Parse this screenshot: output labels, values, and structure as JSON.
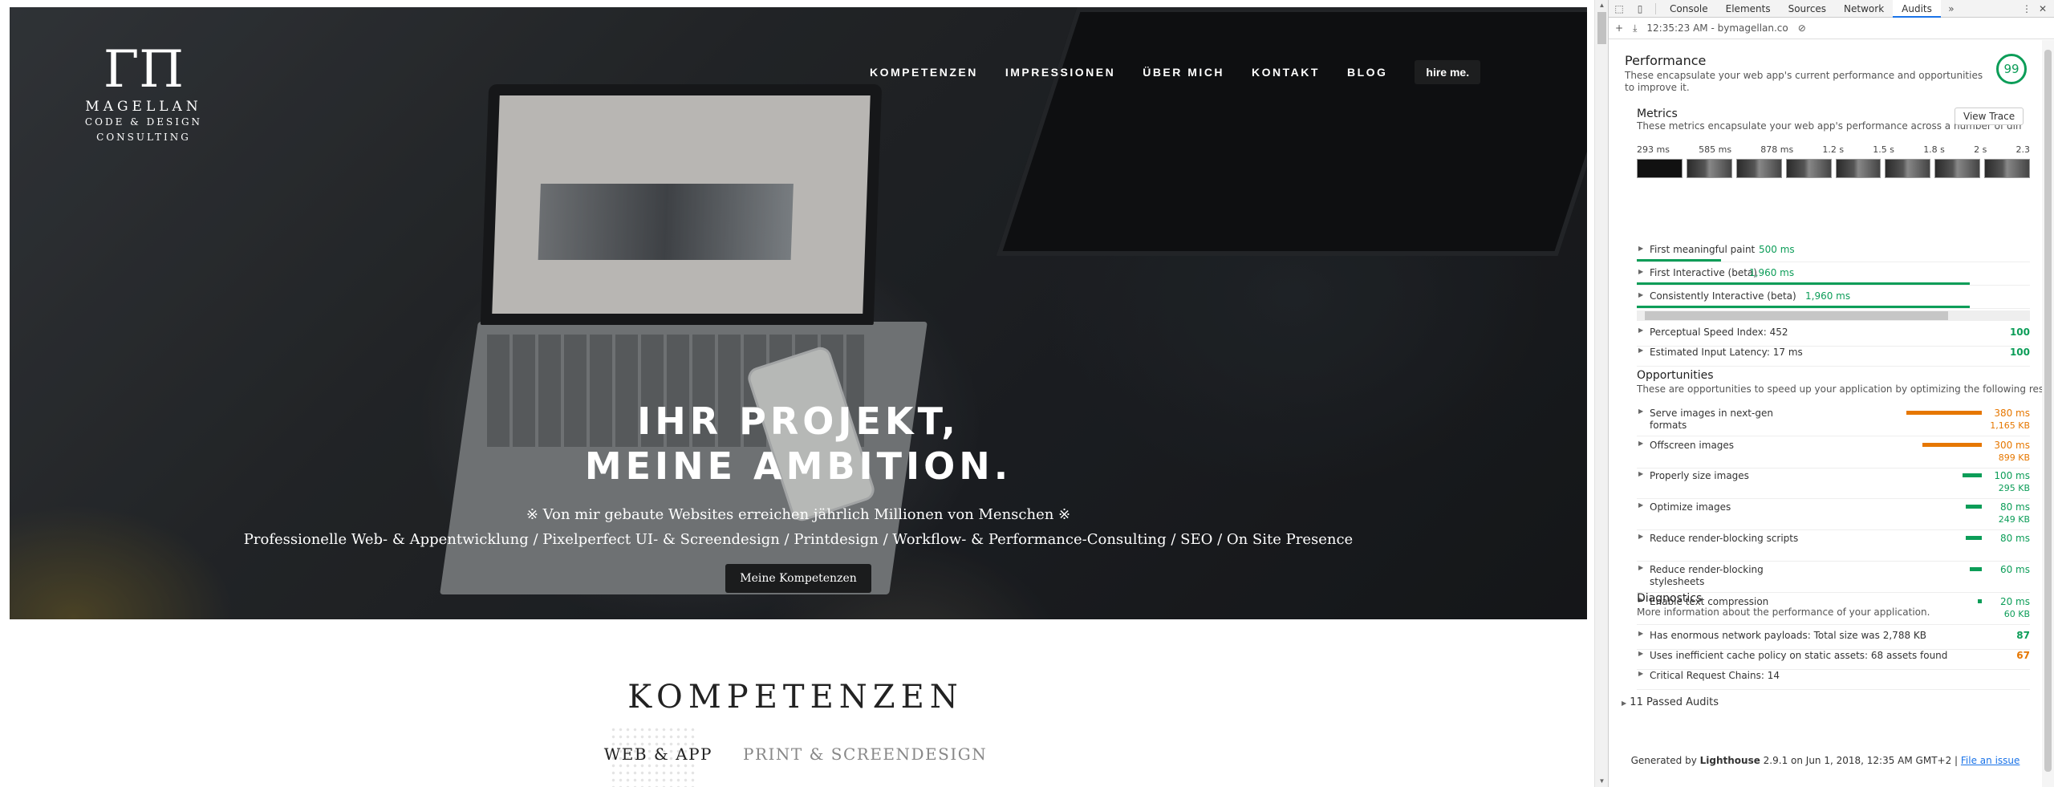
{
  "site": {
    "brand": {
      "mark": "ΓΠ",
      "name": "MAGELLAN",
      "sub1": "CODE & DESIGN",
      "sub2": "CONSULTING"
    },
    "nav": [
      "KOMPETENZEN",
      "IMPRESSIONEN",
      "ÜBER MICH",
      "KONTAKT",
      "BLOG"
    ],
    "hire": "hire me.",
    "hero": {
      "title1": "IHR PROJEKT,",
      "title2": "MEINE AMBITION.",
      "sub1": "※ Von mir gebaute Websites erreichen jährlich Millionen von Menschen ※",
      "sub2": "Professionelle Web- & Appentwicklung / Pixelperfect UI- & Screendesign / Printdesign / Workflow- & Performance-Consulting / SEO / On Site Presence",
      "button": "Meine Kompetenzen"
    },
    "kompetenzen": {
      "title": "KOMPETENZEN",
      "tab_active": "WEB & APP",
      "tab_inactive": "PRINT & SCREENDESIGN"
    }
  },
  "devtools": {
    "tabs": [
      "Console",
      "Elements",
      "Sources",
      "Network",
      "Audits"
    ],
    "active_tab": "Audits",
    "toolbar_run": "12:35:23 AM - bymagellan.co",
    "performance": {
      "title": "Performance",
      "desc": "These encapsulate your web app's current performance and opportunities to improve it.",
      "score": "99"
    },
    "metrics": {
      "title": "Metrics",
      "desc": "These metrics encapsulate your web app's performance across a number of dimensions.",
      "view_trace": "View Trace",
      "film_times": [
        "293 ms",
        "585 ms",
        "878 ms",
        "1.2 s",
        "1.5 s",
        "1.8 s",
        "2 s",
        "2.3"
      ],
      "rows": [
        {
          "label": "First meaningful paint",
          "value": "500 ms"
        },
        {
          "label": "First Interactive (beta)",
          "value": "1,960 ms"
        },
        {
          "label": "Consistently Interactive (beta)",
          "value": "1,960 ms"
        }
      ],
      "scored": [
        {
          "label": "Perceptual Speed Index: 452",
          "score": "100"
        },
        {
          "label": "Estimated Input Latency: 17 ms",
          "score": "100"
        }
      ]
    },
    "opportunities": {
      "title": "Opportunities",
      "desc": "These are opportunities to speed up your application by optimizing the following resources.",
      "items": [
        {
          "label1": "Serve images in next-gen",
          "label2": "formats",
          "ms": "380 ms",
          "kb": "1,165 KB",
          "severity": "orange",
          "weight": 1.0
        },
        {
          "label1": "Offscreen images",
          "label2": "",
          "ms": "300 ms",
          "kb": "899 KB",
          "severity": "orange",
          "weight": 0.79
        },
        {
          "label1": "Properly size images",
          "label2": "",
          "ms": "100 ms",
          "kb": "295 KB",
          "severity": "green",
          "weight": 0.26
        },
        {
          "label1": "Optimize images",
          "label2": "",
          "ms": "80 ms",
          "kb": "249 KB",
          "severity": "green",
          "weight": 0.21
        },
        {
          "label1": "Reduce render-blocking scripts",
          "label2": "",
          "ms": "80 ms",
          "kb": "",
          "severity": "green",
          "weight": 0.21
        },
        {
          "label1": "Reduce render-blocking",
          "label2": "stylesheets",
          "ms": "60 ms",
          "kb": "",
          "severity": "green",
          "weight": 0.16
        },
        {
          "label1": "Enable text compression",
          "label2": "",
          "ms": "20 ms",
          "kb": "60 KB",
          "severity": "green",
          "weight": 0.05
        }
      ]
    },
    "diagnostics": {
      "title": "Diagnostics",
      "desc": "More information about the performance of your application.",
      "items": [
        {
          "label": "Has enormous network payloads: Total size was 2,788 KB",
          "score": "87",
          "severity": "green"
        },
        {
          "label": "Uses inefficient cache policy on static assets: 68 assets found",
          "score": "67",
          "severity": "orange"
        },
        {
          "label": "Critical Request Chains: 14",
          "score": "",
          "severity": "green"
        }
      ]
    },
    "passed": "11 Passed Audits",
    "footer": {
      "prefix": "Generated by ",
      "tool": "Lighthouse",
      "rest": " 2.9.1 on Jun 1, 2018, 12:35 AM GMT+2 | ",
      "link": "File an issue"
    }
  },
  "colors": {
    "green": "#0c9d58",
    "orange": "#e67700",
    "accent": "#1a73e8"
  }
}
